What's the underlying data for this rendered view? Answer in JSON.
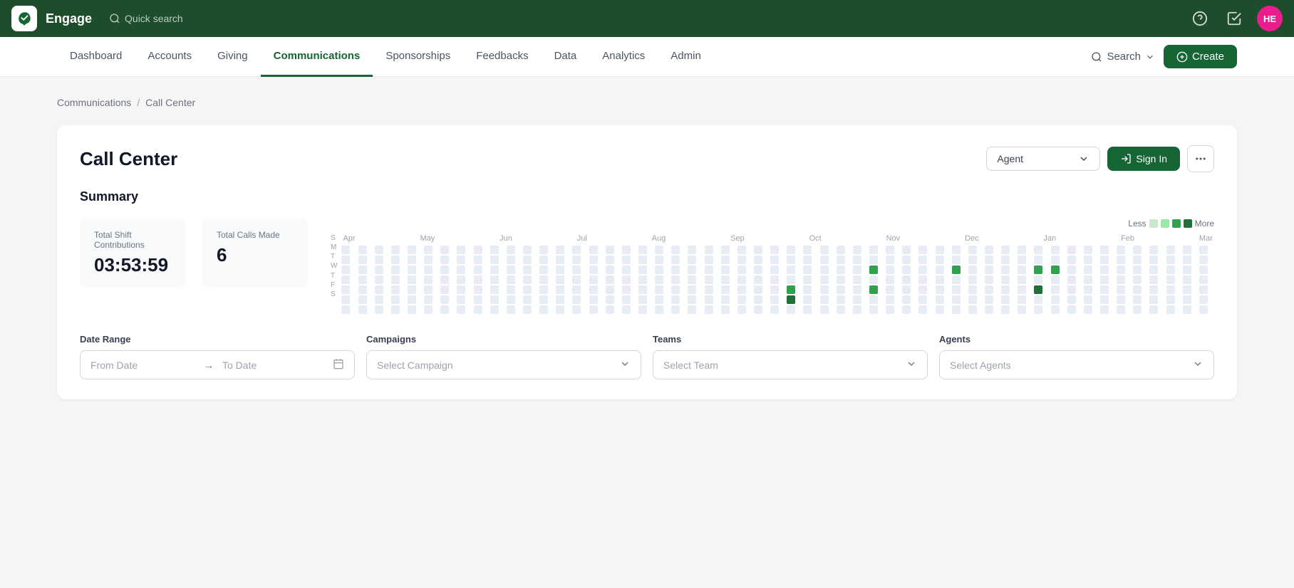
{
  "app": {
    "name": "Engage",
    "user_initials": "HE"
  },
  "top_bar": {
    "search_placeholder": "Quick search"
  },
  "nav": {
    "items": [
      {
        "label": "Dashboard",
        "active": false
      },
      {
        "label": "Accounts",
        "active": false
      },
      {
        "label": "Giving",
        "active": false
      },
      {
        "label": "Communications",
        "active": true
      },
      {
        "label": "Sponsorships",
        "active": false
      },
      {
        "label": "Feedbacks",
        "active": false
      },
      {
        "label": "Data",
        "active": false
      },
      {
        "label": "Analytics",
        "active": false
      },
      {
        "label": "Admin",
        "active": false
      }
    ],
    "search_label": "Search",
    "create_label": "Create"
  },
  "breadcrumb": {
    "parent": "Communications",
    "separator": "/",
    "current": "Call Center"
  },
  "page": {
    "title": "Call Center",
    "agent_selector": "Agent",
    "sign_in_label": "Sign In"
  },
  "summary": {
    "title": "Summary",
    "stats": [
      {
        "label": "Total Shift Contributions",
        "value": "03:53:59"
      },
      {
        "label": "Total Calls Made",
        "value": "6"
      }
    ],
    "legend": {
      "less": "Less",
      "more": "More"
    },
    "months": [
      "Apr",
      "May",
      "Jun",
      "Jul",
      "Aug",
      "Sep",
      "Oct",
      "Nov",
      "Dec",
      "Jan",
      "Feb",
      "Mar"
    ],
    "day_labels": [
      "S",
      "M",
      "T",
      "W",
      "T",
      "F",
      "S"
    ]
  },
  "filters": {
    "date_range": {
      "label": "Date Range",
      "from_placeholder": "From Date",
      "to_placeholder": "To Date"
    },
    "campaigns": {
      "label": "Campaigns",
      "placeholder": "Select Campaign"
    },
    "teams": {
      "label": "Teams",
      "placeholder": "Select Team"
    },
    "agents": {
      "label": "Agents",
      "placeholder": "Select Agents"
    }
  }
}
